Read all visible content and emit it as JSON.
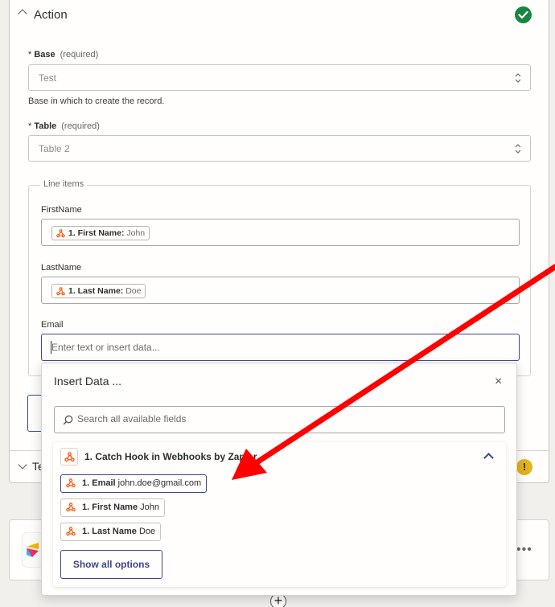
{
  "action": {
    "title": "Action"
  },
  "base": {
    "label": "Base",
    "required": "(required)",
    "value": "Test",
    "help": "Base in which to create the record."
  },
  "table": {
    "label": "Table",
    "required": "(required)",
    "value": "Table 2"
  },
  "line_items": {
    "legend": "Line items",
    "first_name": {
      "label": "FirstName",
      "pill_key": "1. First Name:",
      "pill_value": "John"
    },
    "last_name": {
      "label": "LastName",
      "pill_key": "1. Last Name:",
      "pill_value": "Doe"
    },
    "email": {
      "label": "Email",
      "placeholder": "Enter text or insert data..."
    }
  },
  "bottom_section": {
    "title": "Te",
    "warning": "!"
  },
  "insert_data": {
    "title": "Insert Data ...",
    "close": "×",
    "search_placeholder": "Search all available fields",
    "group_title": "1. Catch Hook in Webhooks by Zapier",
    "options": [
      {
        "key": "1. Email",
        "value": "john.doe@gmail.com"
      },
      {
        "key": "1. First Name",
        "value": "John"
      },
      {
        "key": "1. Last Name",
        "value": "Doe"
      }
    ],
    "show_all": "Show all options"
  },
  "more": "•••",
  "plus": "+",
  "colors": {
    "accent": "#3d4592",
    "success": "#168742",
    "warning": "#e3b41b",
    "hook": "#ff4f00",
    "arrow": "#ff0000"
  }
}
